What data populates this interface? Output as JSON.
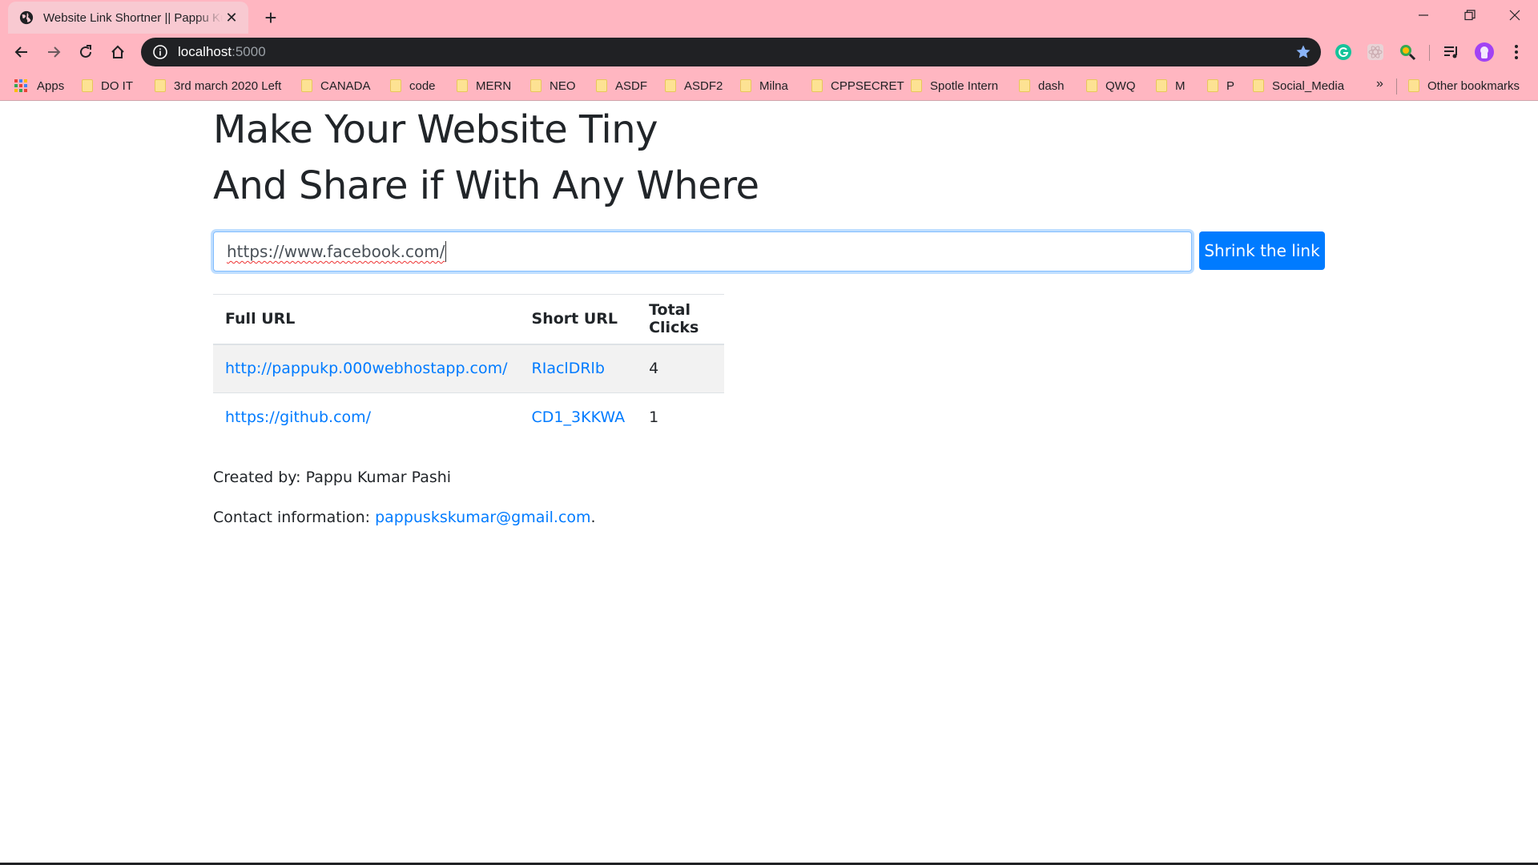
{
  "browser": {
    "tab_title": "Website Link Shortner || Pappu Kumar Pashi",
    "url_host": "localhost",
    "url_port": ":5000",
    "bookmarks": [
      "Apps",
      "DO IT",
      "3rd march 2020 Left",
      "CANADA",
      "code",
      "MERN",
      "NEO",
      "ASDF",
      "ASDF2",
      "Milna",
      "CPPSECRET",
      "Spotle Intern",
      "dash",
      "QWQ",
      "M",
      "P",
      "Social_Media"
    ],
    "more_bookmarks": "»",
    "other_bookmarks": "Other bookmarks"
  },
  "page": {
    "heading_line1": "Make Your Website Tiny",
    "heading_line2": "And Share if With Any Where",
    "input_value": "https://www.facebook.com/",
    "button_label": "Shrink the link",
    "table": {
      "headers": [
        "Full URL",
        "Short URL",
        "Total Clicks"
      ],
      "rows": [
        {
          "full": "http://pappukp.000webhostapp.com/",
          "short": "RIaclDRlb",
          "clicks": "4"
        },
        {
          "full": "https://github.com/",
          "short": "CD1_3KKWA",
          "clicks": "1"
        }
      ]
    },
    "created_by": "Created by: Pappu Kumar Pashi",
    "contact_label": "Contact information: ",
    "contact_email": "pappuskskumar@gmail.com",
    "contact_end": "."
  },
  "colors": {
    "chrome_pink": "#ffb6c1",
    "primary": "#007bff",
    "text": "#212529"
  }
}
